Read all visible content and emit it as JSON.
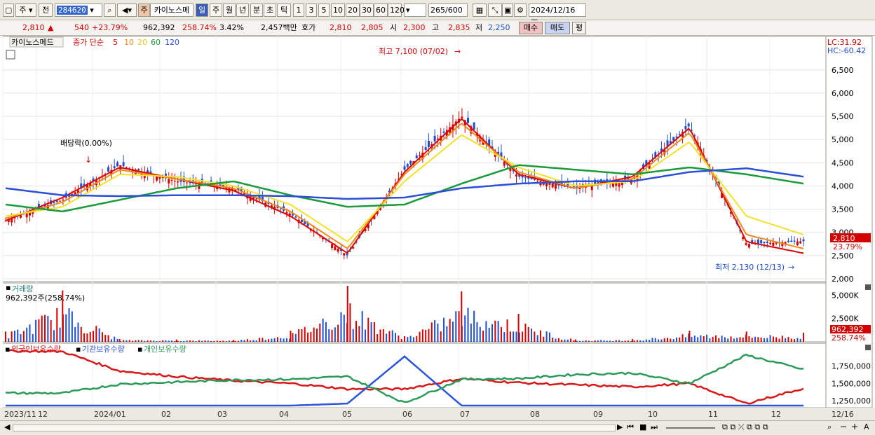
{
  "toolbar": {
    "mode": "주",
    "prev": "전",
    "code": "284620",
    "market_badge": "주",
    "stock_name": "카이노스메",
    "periods": [
      "일",
      "주",
      "월",
      "년",
      "분",
      "초",
      "틱"
    ],
    "active_period": "일",
    "intervals": [
      "1",
      "3",
      "5",
      "10",
      "20",
      "30",
      "60",
      "120"
    ],
    "count": "265",
    "count_total": "/600",
    "date": "2024/12/16"
  },
  "quote": {
    "price": "2,810",
    "change": "540",
    "change_pct": "+23.79%",
    "volume": "962,392",
    "volume_pct": "258.74%",
    "turnover_pct": "3.42%",
    "amount": "2,457백만",
    "hoga_label": "호가",
    "ask": "2,810",
    "bid": "2,805",
    "open_label": "시",
    "open": "2,300",
    "high_label": "고",
    "high": "2,835",
    "low_label": "저",
    "low": "2,250",
    "buy_btn": "매수",
    "sell_btn": "매도",
    "eval_btn": "평"
  },
  "price_panel": {
    "name_label": "카이노스메드",
    "series_label": "종가 단순",
    "ma_labels": [
      "5",
      "10",
      "20",
      "60",
      "120"
    ],
    "lc": "LC:31.92",
    "hc": "HC:-60.42",
    "high_annot": "최고 7,100 (07/02)",
    "low_annot": "최저 2,130 (12/13)",
    "div_annot": "배당락(0.00%)",
    "current_price_tag": "2,810",
    "current_pct_tag": "23.79%"
  },
  "volume_panel": {
    "label": "거래량",
    "value": "962,392주(258.74%)",
    "tag_value": "962,392",
    "tag_pct": "258.74%"
  },
  "holding_panel": {
    "labels": [
      "외국인보유수량",
      "기관보유수량",
      "개인보유수량"
    ]
  },
  "x_axis": {
    "labels": [
      "2023/11",
      "12",
      "2024/01",
      "02",
      "03",
      "04",
      "05",
      "06",
      "07",
      "08",
      "09",
      "10",
      "11",
      "12",
      "12/16"
    ]
  },
  "colors": {
    "up": "#d40000",
    "down": "#1e4fd0",
    "ma5": "#e00000",
    "ma10": "#f08a1c",
    "ma20": "#f5e12a",
    "ma60": "#1a9a3a",
    "ma120": "#2b4fd8",
    "foreign": "#d81818",
    "institution": "#2a55d8",
    "individual": "#2b9a5a"
  },
  "chart_data": [
    {
      "type": "line",
      "title": "카이노스메드 종가 단순",
      "ylim": [
        2000,
        7100
      ],
      "y_ticks": [
        2000,
        2500,
        3000,
        3500,
        4000,
        4500,
        5000,
        5500,
        6000,
        6500
      ],
      "series": [
        {
          "name": "종가",
          "x": [
            "2023/11",
            "2023/12",
            "2024/01",
            "2024/02",
            "2024/03",
            "2024/04",
            "2024/05",
            "2024/06",
            "2024/07",
            "2024/08",
            "2024/09",
            "2024/10",
            "2024/11",
            "2024/12",
            "2024/12/16"
          ],
          "values": [
            3250,
            3700,
            4450,
            4100,
            3950,
            3400,
            2500,
            4350,
            5500,
            4200,
            3950,
            4150,
            5300,
            2750,
            2810
          ]
        },
        {
          "name": "5",
          "values": [
            3250,
            3750,
            4400,
            4150,
            3900,
            3350,
            2550,
            4300,
            5450,
            4250,
            3950,
            4200,
            5250,
            2800,
            2550
          ]
        },
        {
          "name": "10",
          "values": [
            3300,
            3650,
            4350,
            4150,
            3950,
            3450,
            2650,
            4250,
            5350,
            4300,
            3950,
            4150,
            5150,
            2950,
            2650
          ]
        },
        {
          "name": "20",
          "values": [
            3350,
            3550,
            4250,
            4200,
            4000,
            3600,
            2800,
            4100,
            5100,
            4400,
            4000,
            4100,
            4950,
            3350,
            2950
          ]
        },
        {
          "name": "60",
          "values": [
            3600,
            3450,
            3700,
            3950,
            4100,
            3800,
            3550,
            3600,
            4050,
            4450,
            4350,
            4250,
            4400,
            4250,
            4050
          ]
        },
        {
          "name": "120",
          "values": [
            3950,
            3800,
            3780,
            3800,
            3800,
            3780,
            3720,
            3750,
            3950,
            4050,
            4100,
            4100,
            4300,
            4380,
            4200
          ]
        }
      ],
      "annotations": [
        "최고 7,100 (07/02)",
        "최저 2,130 (12/13)",
        "배당락(0.00%)"
      ]
    },
    {
      "type": "bar",
      "title": "거래량",
      "ylim": [
        0,
        6000000
      ],
      "y_ticks": [
        2500000,
        5000000
      ],
      "categories": [
        "2023/11",
        "2023/12",
        "2024/01",
        "2024/02",
        "2024/03",
        "2024/04",
        "2024/05",
        "2024/06",
        "2024/07",
        "2024/08",
        "2024/09",
        "2024/10",
        "2024/11",
        "2024/12",
        "2024/12/16"
      ],
      "values": [
        1100000,
        5500000,
        300000,
        250000,
        200000,
        1200000,
        6000000,
        600000,
        5400000,
        3000000,
        250000,
        300000,
        1200000,
        1100000,
        962392
      ]
    },
    {
      "type": "line",
      "title": "보유수량",
      "ylim": [
        1150000,
        2050000
      ],
      "y_ticks": [
        1250000,
        1500000,
        1750000
      ],
      "series": [
        {
          "name": "외국인보유수량",
          "values": [
            1970000,
            1960000,
            1680000,
            1600000,
            1540000,
            1500000,
            1420000,
            1420000,
            1570000,
            1510000,
            1480000,
            1450000,
            1500000,
            1210000,
            1430000
          ]
        },
        {
          "name": "기관보유수량",
          "values": [
            1180000,
            1180000,
            1180000,
            1180000,
            1180000,
            1180000,
            1210000,
            1890000,
            1180000,
            1180000,
            1180000,
            1180000,
            1180000,
            1180000,
            1180000
          ]
        },
        {
          "name": "개인보유수량",
          "values": [
            1360000,
            1360000,
            1490000,
            1520000,
            1550000,
            1560000,
            1600000,
            1220000,
            1560000,
            1570000,
            1630000,
            1650000,
            1500000,
            1910000,
            1700000
          ]
        }
      ]
    }
  ]
}
